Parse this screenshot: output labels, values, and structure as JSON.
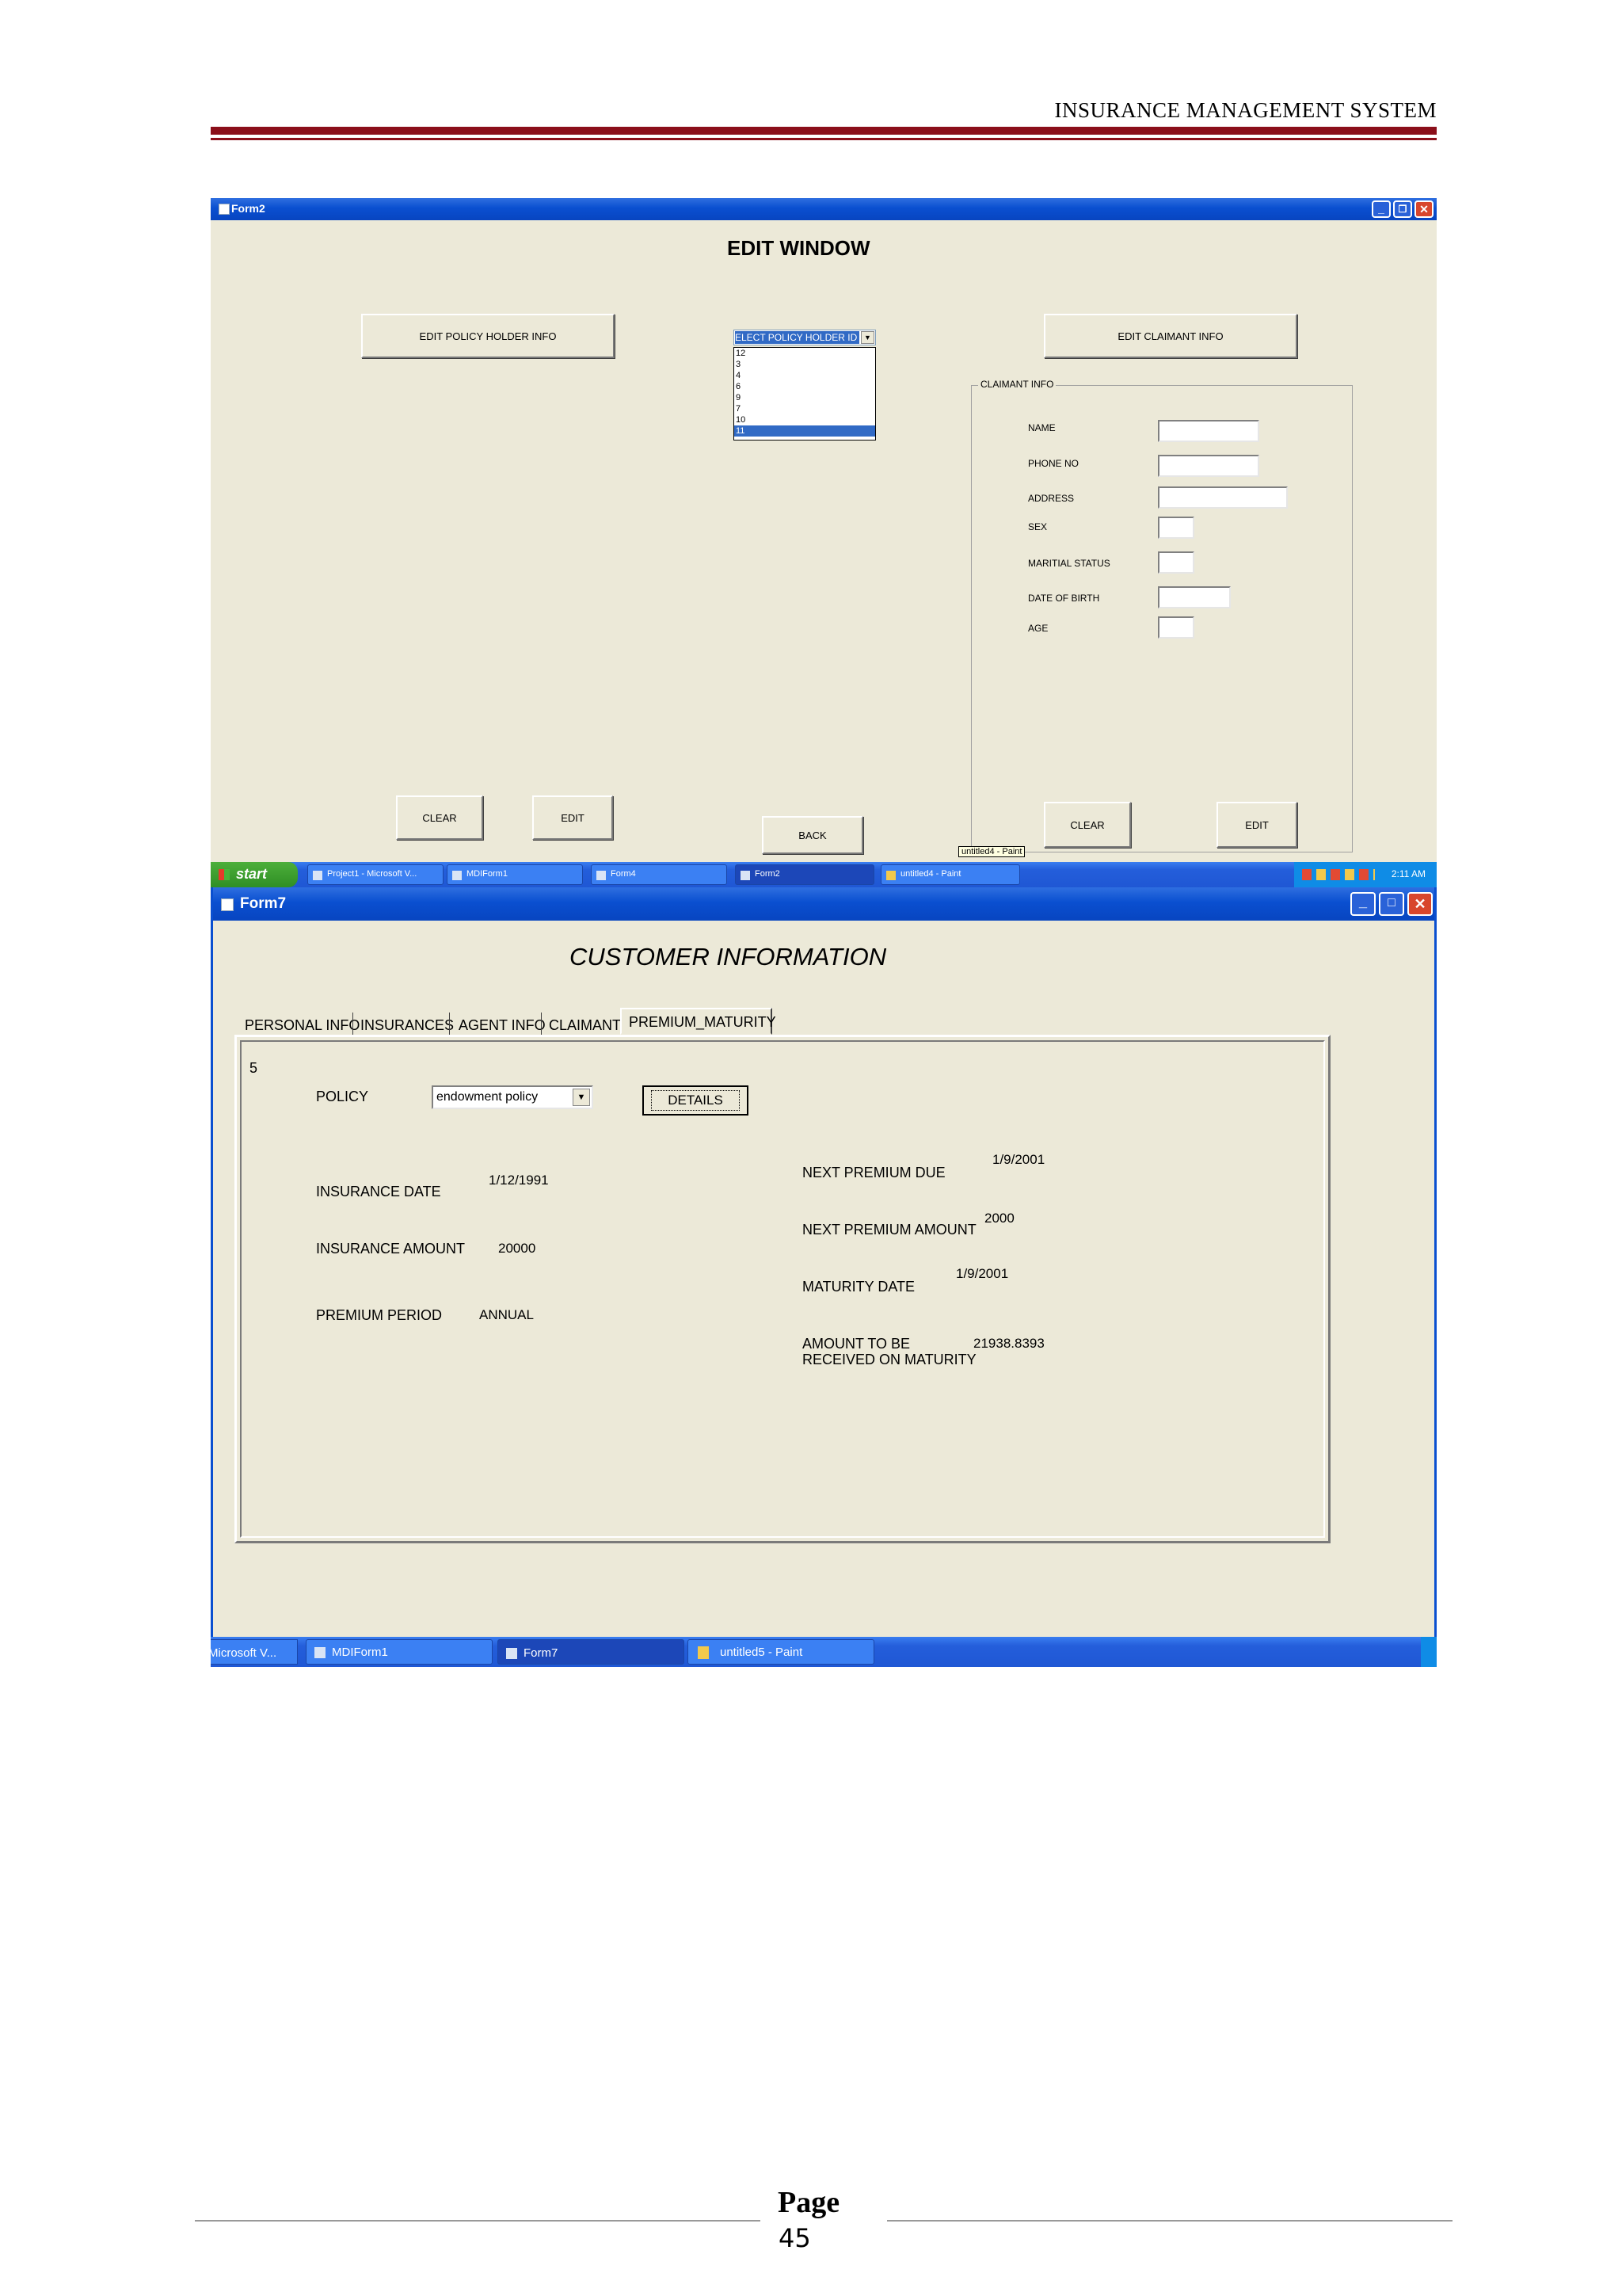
{
  "header": {
    "title": "INSURANCE  MANAGEMENT SYSTEM"
  },
  "form2": {
    "window_title": "Form2",
    "heading": "EDIT WINDOW",
    "edit_policy_holder_button": "EDIT POLICY HOLDER INFO",
    "edit_claimant_button": "EDIT CLAIMANT INFO",
    "policy_holder_select": {
      "selected": "ELECT POLICY HOLDER ID",
      "options": [
        "12",
        "3",
        "4",
        "6",
        "9",
        "7",
        "10",
        "11"
      ],
      "highlighted": "11"
    },
    "claimant_frame_title": "CLAIMANT INFO",
    "claimant_fields": {
      "name": "NAME",
      "phone": "PHONE NO",
      "address": "ADDRESS",
      "sex": "SEX",
      "marital_status": "MARITIAL STATUS",
      "dob": "DATE OF BIRTH",
      "age": "AGE"
    },
    "clear_left": "CLEAR",
    "edit_left": "EDIT",
    "back": "BACK",
    "clear_right": "CLEAR",
    "edit_right": "EDIT",
    "tooltip": "untitled4 - Paint"
  },
  "taskbar1": {
    "start": "start",
    "items": [
      "Project1 - Microsoft V...",
      "MDIForm1",
      "Form4",
      "Form2",
      "untitled4 - Paint"
    ],
    "clock": "2:11 AM"
  },
  "form7": {
    "window_title": "Form7",
    "heading": "CUSTOMER INFORMATION",
    "tabs": [
      "PERSONAL INFO",
      "INSURANCES",
      "AGENT INFO",
      "CLAIMANT",
      "PREMIUM_MATURITY"
    ],
    "record_number": "5",
    "policy_label": "POLICY",
    "policy_value": "endowment policy",
    "details_button": "DETAILS",
    "insurance_date_label": "INSURANCE DATE",
    "insurance_date_value": "1/12/1991",
    "insurance_amount_label": "INSURANCE AMOUNT",
    "insurance_amount_value": "20000",
    "premium_period_label": "PREMIUM PERIOD",
    "premium_period_value": "ANNUAL",
    "next_premium_due_label": "NEXT PREMIUM DUE",
    "next_premium_due_value": "1/9/2001",
    "next_premium_amount_label": "NEXT PREMIUM AMOUNT",
    "next_premium_amount_value": "2000",
    "maturity_date_label": "MATURITY DATE",
    "maturity_date_value": "1/9/2001",
    "amount_maturity_label_1": "AMOUNT TO BE",
    "amount_maturity_label_2": "RECEIVED ON MATURITY",
    "amount_maturity_value": "21938.8393"
  },
  "taskbar2": {
    "items": [
      "Microsoft V...",
      "MDIForm1",
      "Form7",
      "untitled5 - Paint"
    ]
  },
  "footer": {
    "page_word": "Page",
    "page_number": "45"
  }
}
